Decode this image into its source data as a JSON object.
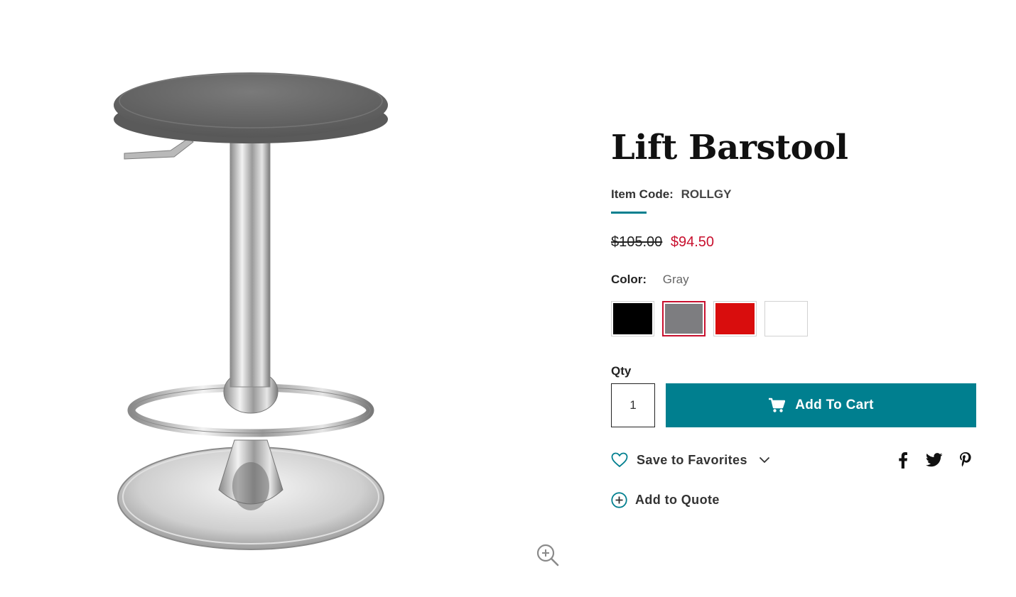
{
  "product": {
    "title": "Lift Barstool",
    "item_code_label": "Item Code:",
    "item_code": "ROLLGY",
    "price_original": "$105.00",
    "price_sale": "$94.50",
    "color_label": "Color:",
    "color_selected": "Gray",
    "swatches": [
      {
        "name": "Black",
        "hex": "#000000"
      },
      {
        "name": "Gray",
        "hex": "#7d7d80"
      },
      {
        "name": "Red",
        "hex": "#d90d0d"
      },
      {
        "name": "White",
        "hex": "#ffffff"
      }
    ],
    "qty_label": "Qty",
    "qty_value": "1",
    "add_to_cart_label": "Add To Cart",
    "save_favorites_label": "Save to Favorites",
    "add_quote_label": "Add to Quote"
  },
  "icons": {
    "cart": "cart-icon",
    "heart": "heart-icon",
    "chevron": "chevron-down-icon",
    "plus_circle": "plus-circle-icon",
    "zoom": "zoom-in-icon",
    "facebook": "facebook-icon",
    "twitter": "twitter-icon",
    "pinterest": "pinterest-icon"
  },
  "colors": {
    "accent_teal": "#007f8f",
    "sale_red": "#c8102e",
    "selected_border": "#c8102e"
  }
}
